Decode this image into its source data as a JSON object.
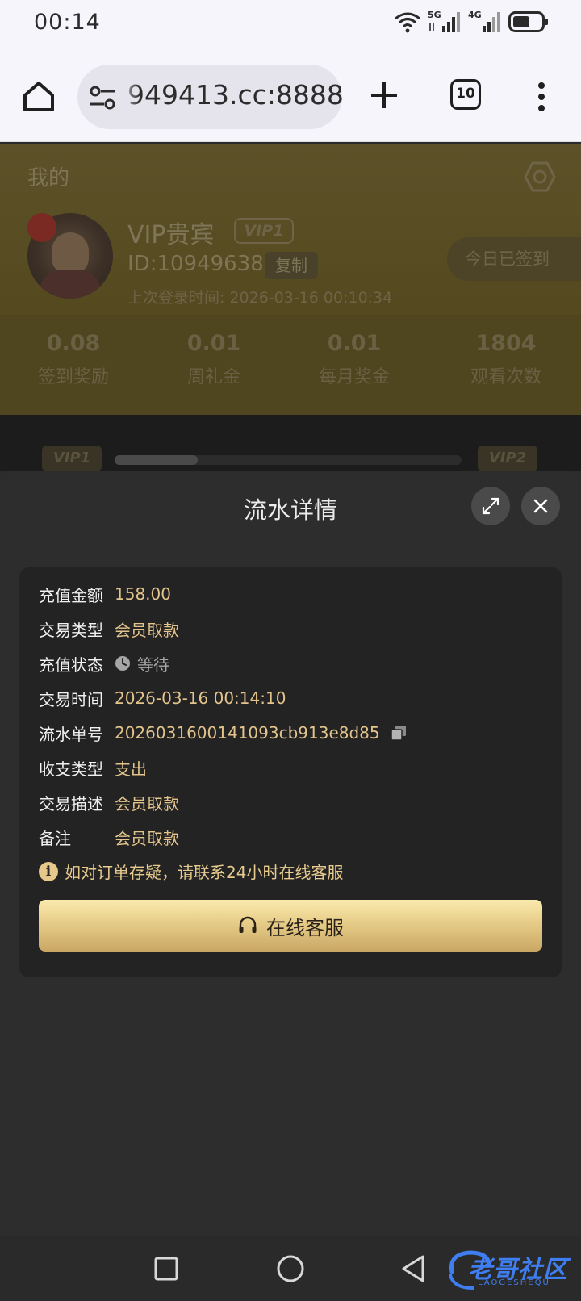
{
  "status_bar": {
    "time": "00:14",
    "net1": "5G",
    "net2": "4G"
  },
  "browser": {
    "url": "949413.cc:8888",
    "tab_count": "10"
  },
  "page": {
    "title": "我的",
    "user": {
      "name": "VIP贵宾",
      "vip_badge": "VIP1",
      "id": "ID:10949638",
      "copy_label": "复制",
      "last_login": "上次登录时间: 2026-03-16 00:10:34",
      "checkin_label": "今日已签到"
    },
    "stats": [
      {
        "value": "0.08",
        "label": "签到奖励"
      },
      {
        "value": "0.01",
        "label": "周礼金"
      },
      {
        "value": "0.01",
        "label": "每月奖金"
      },
      {
        "value": "1804",
        "label": "观看次数"
      }
    ],
    "vip_progress": {
      "from": "VIP1",
      "to": "VIP2",
      "fraction": 0.24
    }
  },
  "sheet": {
    "title": "流水详情",
    "rows": [
      {
        "label": "充值金额",
        "value": "158.00"
      },
      {
        "label": "交易类型",
        "value": "会员取款"
      },
      {
        "label": "充值状态",
        "value": "等待"
      },
      {
        "label": "交易时间",
        "value": "2026-03-16 00:14:10"
      },
      {
        "label": "流水单号",
        "value": "2026031600141093cb913e8d85"
      },
      {
        "label": "收支类型",
        "value": "支出"
      },
      {
        "label": "交易描述",
        "value": "会员取款"
      },
      {
        "label": "备注",
        "value": "会员取款"
      }
    ],
    "notice": "如对订单存疑，请联系24小时在线客服",
    "service_button": "在线客服"
  },
  "watermark": {
    "text": "老哥社区",
    "sub": "LAOGESHEQU"
  },
  "colors": {
    "accent_gold": "#e3c48c",
    "button_gold": "#e6cc88",
    "sheet_bg": "#2d2d2d",
    "card_bg": "#232323"
  }
}
